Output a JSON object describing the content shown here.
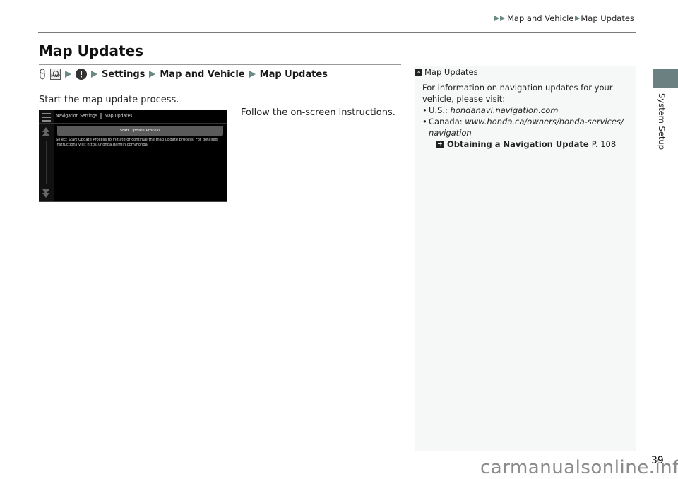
{
  "header": {
    "breadcrumb": [
      "Map and Vehicle",
      "Map Updates"
    ]
  },
  "side_tab": {
    "label": "System Setup",
    "color": "#6b8080"
  },
  "page": {
    "title": "Map Updates",
    "path": {
      "icons": [
        "voice-command-icon",
        "map-button-icon",
        "menu-icon"
      ],
      "steps": [
        "Settings",
        "Map and Vehicle",
        "Map Updates"
      ]
    },
    "intro": "Start the map update process.",
    "follow": "Follow the on-screen instructions."
  },
  "screen": {
    "title": "Navigation Settings",
    "subtitle": "Map Updates",
    "button": "Start Update Process",
    "description": "Select Start Update Process to initiate or continue the map update process. For detailed instructions visit https://honda.garmin.com/honda."
  },
  "note": {
    "heading": "Map Updates",
    "intro": "For information on navigation updates for your vehicle, please visit:",
    "items": [
      {
        "label": "U.S.:",
        "url": "hondanavi.navigation.com"
      },
      {
        "label": "Canada:",
        "url": "www.honda.ca/owners/honda-services/",
        "url_cont": "navigation"
      }
    ],
    "xref": {
      "title": "Obtaining a Navigation Update",
      "page": "P. 108"
    }
  },
  "footer": {
    "page_number": "39",
    "watermark": "carmanualsonline.info"
  },
  "colors": {
    "accent_triangle": "#6a8a86",
    "sidebar_bg": "#f6f7f7"
  }
}
